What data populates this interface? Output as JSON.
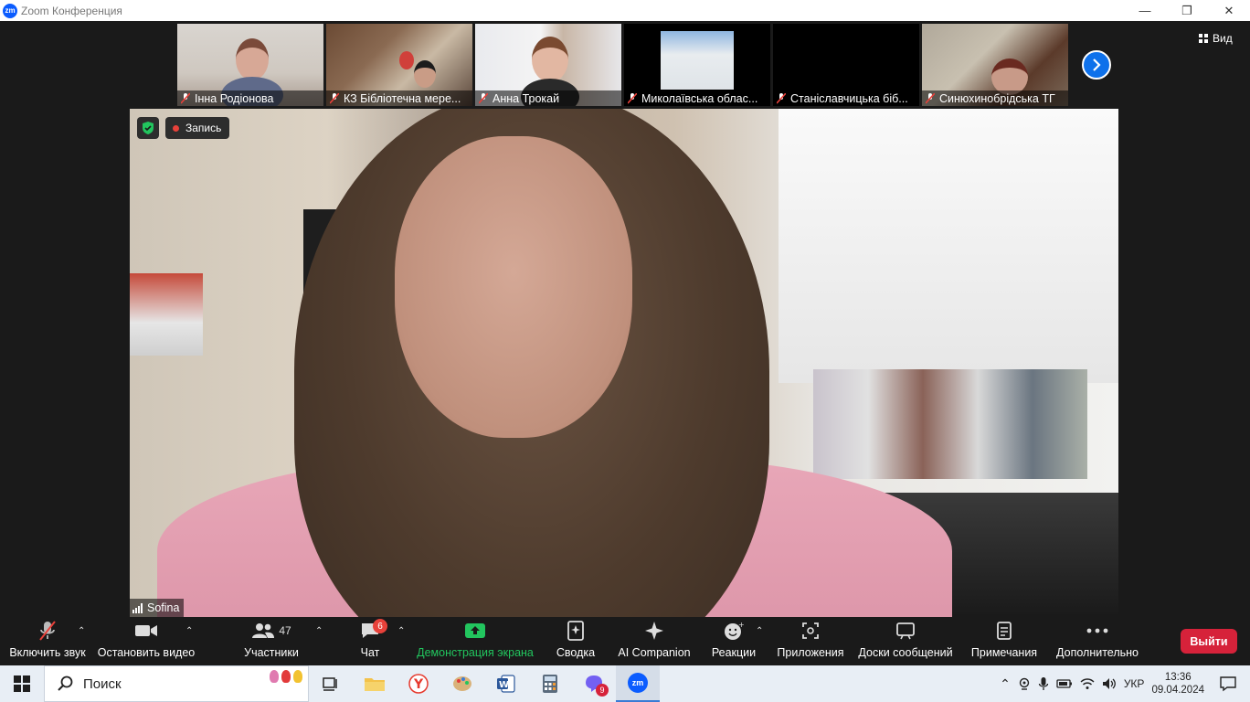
{
  "titlebar": {
    "title": "Zoom Конференция",
    "logo": "zm"
  },
  "participants_strip": [
    {
      "name": "Інна Родіонова"
    },
    {
      "name": "КЗ Бібліотечна мере..."
    },
    {
      "name": "Анна Трокай"
    },
    {
      "name": "Миколаївська облас..."
    },
    {
      "name": "Станіславчицька біб..."
    },
    {
      "name": "Синюхинобрідська ТГ"
    }
  ],
  "view_button": {
    "label": "Вид"
  },
  "recording": {
    "label": "Запись"
  },
  "speaker": {
    "name": "Sofina"
  },
  "toolbar": {
    "unmute": "Включить звук",
    "stop_video": "Остановить видео",
    "participants": "Участники",
    "participants_count": "47",
    "chat": "Чат",
    "chat_badge": "6",
    "share": "Демонстрация экрана",
    "summary": "Сводка",
    "ai_companion": "AI Companion",
    "reactions": "Реакции",
    "apps": "Приложения",
    "whiteboards": "Доски сообщений",
    "notes": "Примечания",
    "more": "Дополнительно",
    "leave": "Выйти"
  },
  "taskbar": {
    "search_placeholder": "Поиск",
    "viber_badge": "9",
    "language": "УКР",
    "time": "13:36",
    "date": "09.04.2024",
    "zoom_label": "zm"
  },
  "colors": {
    "accent": "#0e71eb",
    "leave": "#d6223a",
    "share_green": "#22c55e",
    "recording": "#e8413a"
  }
}
